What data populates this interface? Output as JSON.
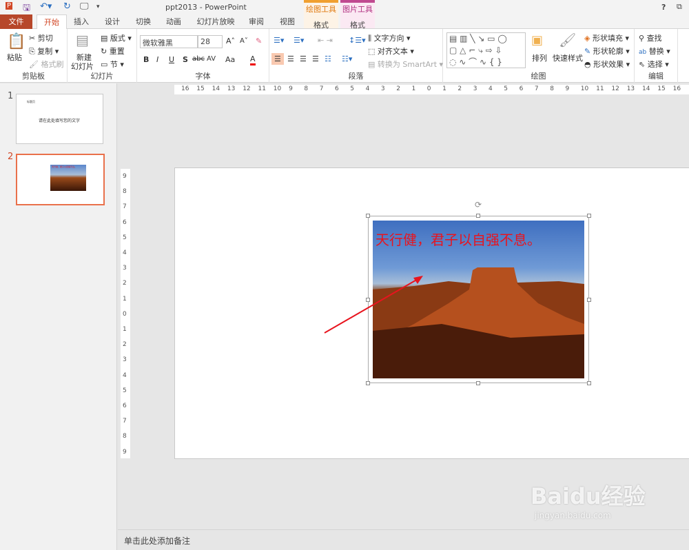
{
  "titlebar": {
    "title": "ppt2013 - PowerPoint",
    "help": "?",
    "restore": "⧉"
  },
  "context_tabs": [
    {
      "group": "绘图工具",
      "tab": "格式",
      "color": "#f0a030"
    },
    {
      "group": "图片工具",
      "tab": "格式",
      "color": "#c04a90"
    }
  ],
  "tabs": [
    "文件",
    "开始",
    "插入",
    "设计",
    "切换",
    "动画",
    "幻灯片放映",
    "审阅",
    "视图"
  ],
  "active_tab": "开始",
  "ribbon": {
    "clipboard": {
      "label": "剪贴板",
      "paste": "粘贴",
      "cut": "剪切",
      "copy": "复制",
      "format_painter": "格式刷"
    },
    "slides": {
      "label": "幻灯片",
      "new_slide_1": "新建",
      "new_slide_2": "幻灯片",
      "layout": "版式",
      "reset": "重置",
      "section": "节"
    },
    "font": {
      "label": "字体",
      "font_name": "微软雅黑",
      "font_size": "28",
      "bold": "B",
      "italic": "I",
      "underline": "U",
      "shadow": "S",
      "strike": "abc",
      "spacing": "AV",
      "case": "Aa",
      "color": "A"
    },
    "paragraph": {
      "label": "段落",
      "text_direction": "文字方向",
      "align_text": "对齐文本",
      "smartart": "转换为 SmartArt"
    },
    "drawing": {
      "label": "绘图",
      "arrange": "排列",
      "quick_styles": "快速样式",
      "shape_fill": "形状填充",
      "shape_outline": "形状轮廓",
      "shape_effects": "形状效果"
    },
    "editing": {
      "label": "编辑",
      "find": "查找",
      "replace": "替换",
      "select": "选择"
    }
  },
  "slides_panel": [
    {
      "number": "1",
      "title": "标题页",
      "text": "请在此处填写您的文字"
    },
    {
      "number": "2",
      "text": "天行健，君子以自强不息。",
      "selected": true
    }
  ],
  "ruler": {
    "h": [
      "16",
      "15",
      "14",
      "13",
      "12",
      "11",
      "10",
      "9",
      "8",
      "7",
      "6",
      "5",
      "4",
      "3",
      "2",
      "1",
      "0",
      "1",
      "2",
      "3",
      "4",
      "5",
      "6",
      "7",
      "8",
      "9",
      "10",
      "11",
      "12",
      "13",
      "14",
      "15",
      "16"
    ],
    "v": [
      "9",
      "8",
      "7",
      "6",
      "5",
      "4",
      "3",
      "2",
      "1",
      "0",
      "1",
      "2",
      "3",
      "4",
      "5",
      "6",
      "7",
      "8",
      "9"
    ]
  },
  "slide": {
    "image_caption": "天行健，君子以自强不息。",
    "caption_color": "#e8141e"
  },
  "notes": {
    "placeholder": "单击此处添加备注"
  },
  "watermark": {
    "brand": "Baidu经验",
    "url": "jingyan.baidu.com"
  }
}
